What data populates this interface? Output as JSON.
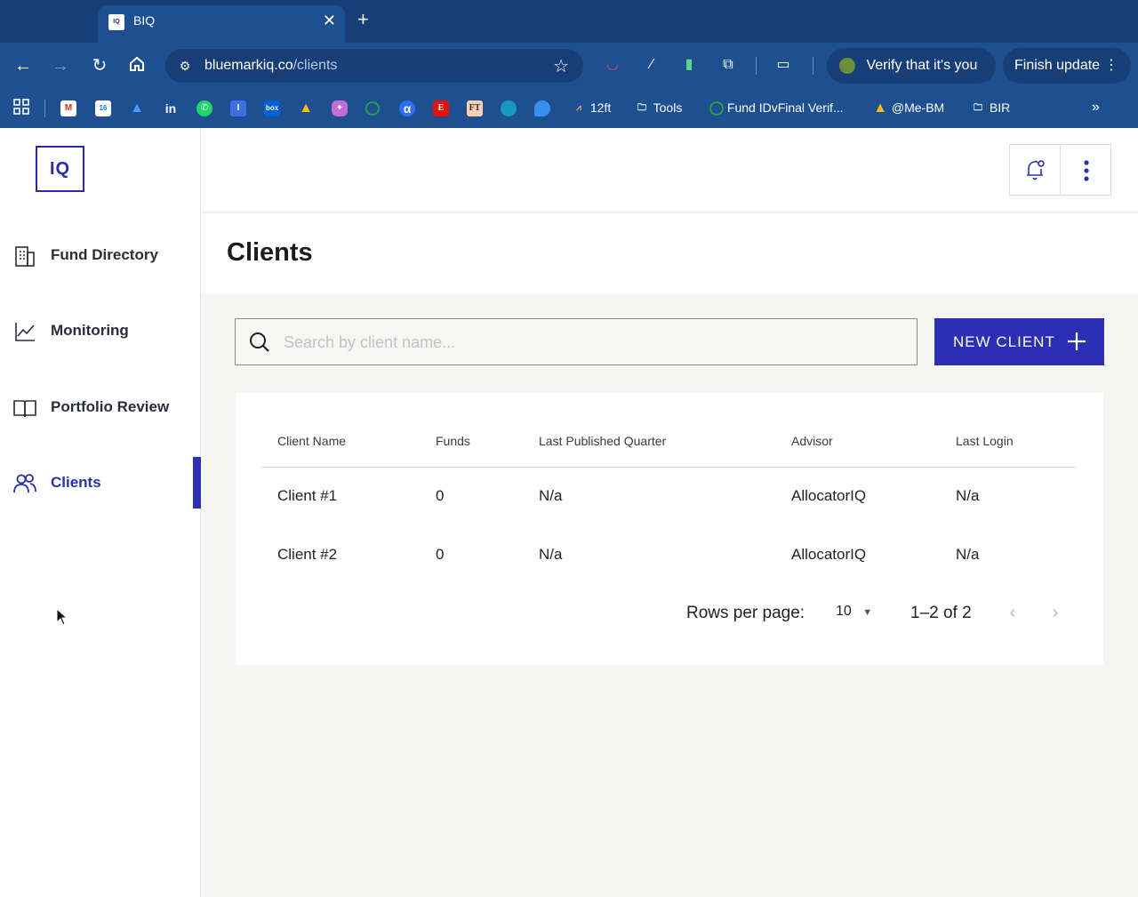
{
  "browser": {
    "tab_title": "BIQ",
    "tab_favicon_text": "IQ",
    "url_domain": "bluemarkiq.co",
    "url_path": "/clients",
    "verify_label": "Verify that it's you",
    "update_label": "Finish update",
    "bookmarks": {
      "twelve_ft": "12ft",
      "tools": "Tools",
      "fund_id": "Fund IDvFinal Verif...",
      "me_bm": "@Me-BM",
      "bir": "BIR"
    },
    "colors": {
      "frame": "#1d4f91",
      "tabstrip": "#173e76"
    }
  },
  "app": {
    "logo_text": "IQ",
    "sidebar": {
      "items": [
        {
          "label": "Fund Directory",
          "icon": "building-icon"
        },
        {
          "label": "Monitoring",
          "icon": "line-chart-icon"
        },
        {
          "label": "Portfolio Review",
          "icon": "book-icon"
        },
        {
          "label": "Clients",
          "icon": "users-icon",
          "active": true
        }
      ]
    },
    "page_title": "Clients",
    "search": {
      "placeholder": "Search by client name...",
      "value": ""
    },
    "new_client_label": "NEW CLIENT",
    "table": {
      "headers": [
        "Client Name",
        "Funds",
        "Last Published Quarter",
        "Advisor",
        "Last Login"
      ],
      "rows": [
        [
          "Client #1",
          "0",
          "N/a",
          "AllocatorIQ",
          "N/a"
        ],
        [
          "Client #2",
          "0",
          "N/a",
          "AllocatorIQ",
          "N/a"
        ]
      ]
    },
    "pagination": {
      "rows_per_page_label": "Rows per page:",
      "rows_per_page_value": "10",
      "range": "1–2 of 2"
    },
    "colors": {
      "primary": "#2b2fb5",
      "text": "#2a2d3a"
    }
  }
}
